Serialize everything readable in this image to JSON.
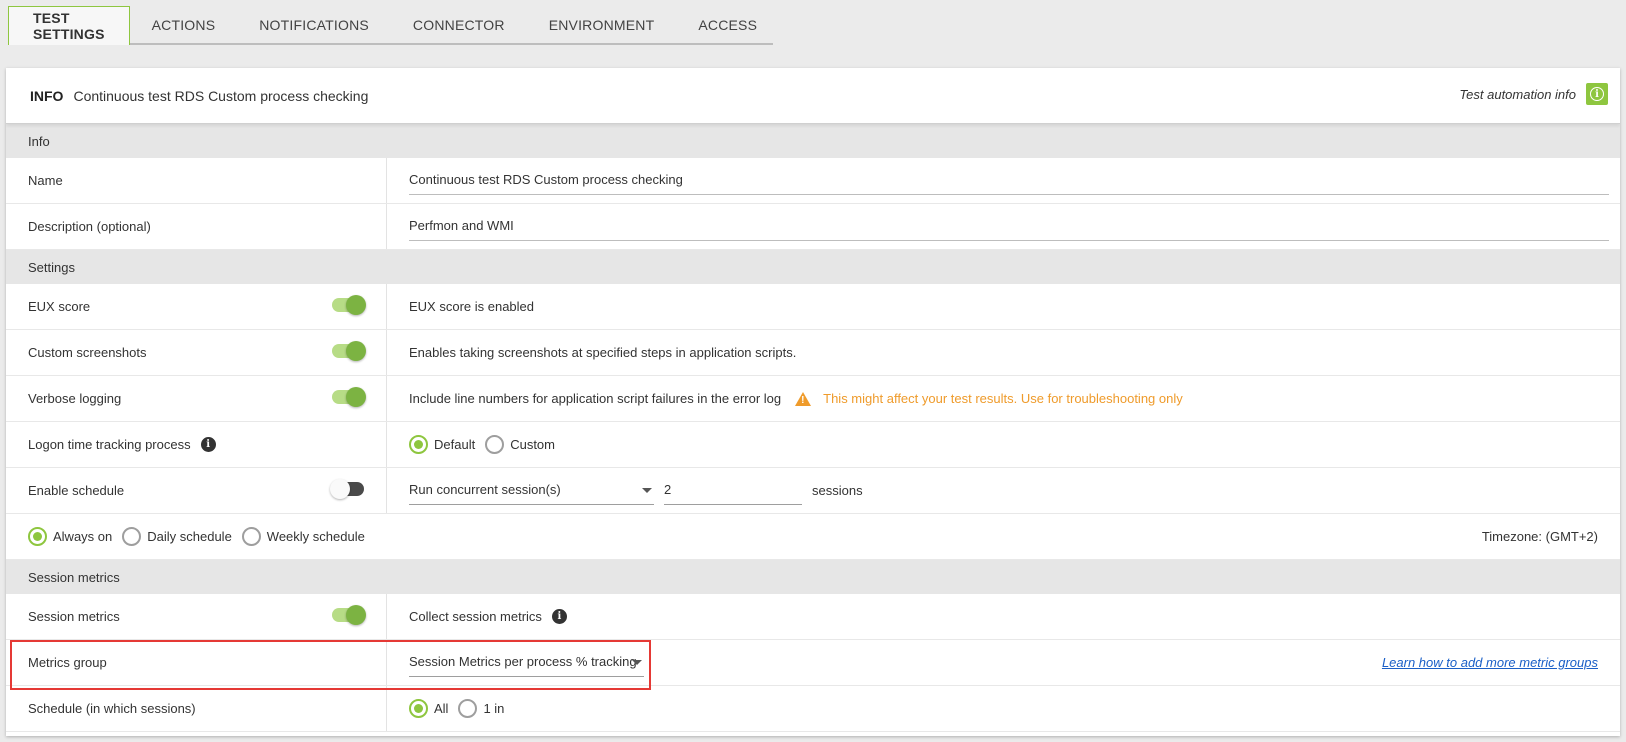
{
  "tabs": [
    "TEST SETTINGS",
    "ACTIONS",
    "NOTIFICATIONS",
    "CONNECTOR",
    "ENVIRONMENT",
    "ACCESS"
  ],
  "header": {
    "title": "INFO",
    "subtitle": "Continuous test RDS Custom process checking",
    "help_text": "Test automation info",
    "info_glyph": "i"
  },
  "sections": {
    "info": "Info",
    "settings": "Settings",
    "session_metrics": "Session metrics"
  },
  "fields": {
    "name_label": "Name",
    "name_value": "Continuous test RDS Custom process checking",
    "description_label": "Description (optional)",
    "description_value": "Perfmon and WMI",
    "eux_label": "EUX score",
    "eux_value": "EUX score is enabled",
    "screenshots_label": "Custom screenshots",
    "screenshots_value": "Enables taking screenshots at specified steps in application scripts.",
    "verbose_label": "Verbose logging",
    "verbose_value": "Include line numbers for application script failures in the error log",
    "verbose_warning": "This might affect your test results. Use for troubleshooting only",
    "logon_label": "Logon time tracking process",
    "logon_options": [
      "Default",
      "Custom"
    ],
    "schedule_label": "Enable schedule",
    "schedule_select": "Run concurrent session(s)",
    "schedule_count": "2",
    "schedule_unit": "sessions",
    "schedule_options": [
      "Always on",
      "Daily schedule",
      "Weekly schedule"
    ],
    "timezone": "Timezone: (GMT+2)",
    "session_metrics_label": "Session metrics",
    "session_metrics_value": "Collect session metrics",
    "metrics_group_label": "Metrics group",
    "metrics_group_value": "Session Metrics per process % tracking",
    "metrics_link": "Learn how to add more metric groups",
    "schedule_sessions_label": "Schedule (in which sessions)",
    "schedule_sessions_options": [
      "All",
      "1 in"
    ]
  },
  "colors": {
    "accent": "#8ec63f",
    "warning": "#ef9b2b",
    "highlight": "#e53935",
    "link": "#1a5fc7"
  }
}
